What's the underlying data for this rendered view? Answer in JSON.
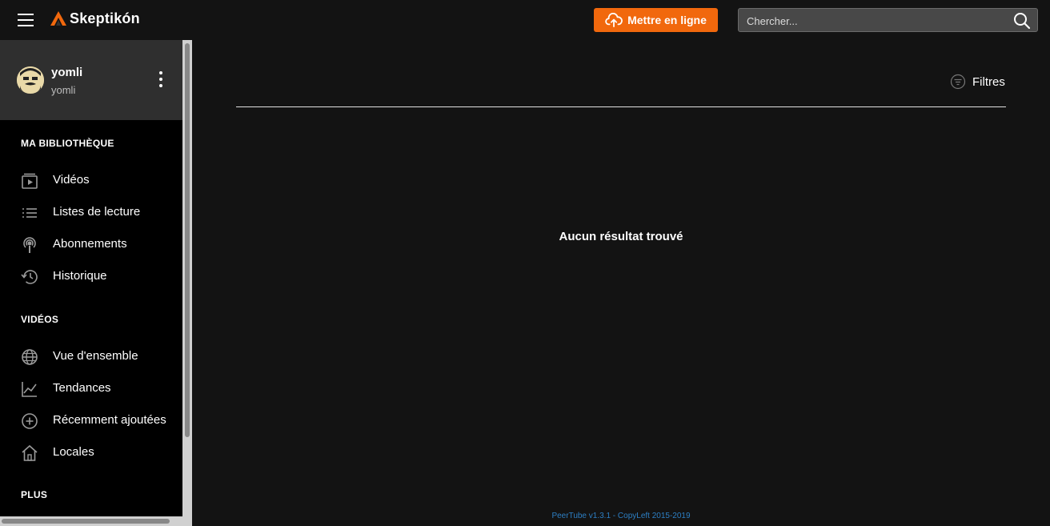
{
  "header": {
    "app_name": "Skeptikón",
    "upload_label": "Mettre en ligne",
    "search_placeholder": "Chercher...",
    "accent_color": "#f1680d"
  },
  "user": {
    "name": "yomli",
    "handle": "yomli"
  },
  "sidebar": {
    "sections": [
      {
        "title": "MA BIBLIOTHÈQUE",
        "items": [
          {
            "label": "Vidéos",
            "icon": "videos-icon"
          },
          {
            "label": "Listes de lecture",
            "icon": "playlist-icon"
          },
          {
            "label": "Abonnements",
            "icon": "subscriptions-icon"
          },
          {
            "label": "Historique",
            "icon": "history-icon"
          }
        ]
      },
      {
        "title": "VIDÉOS",
        "items": [
          {
            "label": "Vue d'ensemble",
            "icon": "globe-icon"
          },
          {
            "label": "Tendances",
            "icon": "trending-icon"
          },
          {
            "label": "Récemment ajoutées",
            "icon": "add-circle-icon"
          },
          {
            "label": "Locales",
            "icon": "home-icon"
          }
        ]
      },
      {
        "title": "PLUS",
        "items": []
      }
    ]
  },
  "main": {
    "filters_label": "Filtres",
    "empty_message": "Aucun résultat trouvé"
  },
  "footer": {
    "version_link": "PeerTube v1.3.1",
    "separator": " - ",
    "copyleft_link": "CopyLeft 2015-2019"
  }
}
